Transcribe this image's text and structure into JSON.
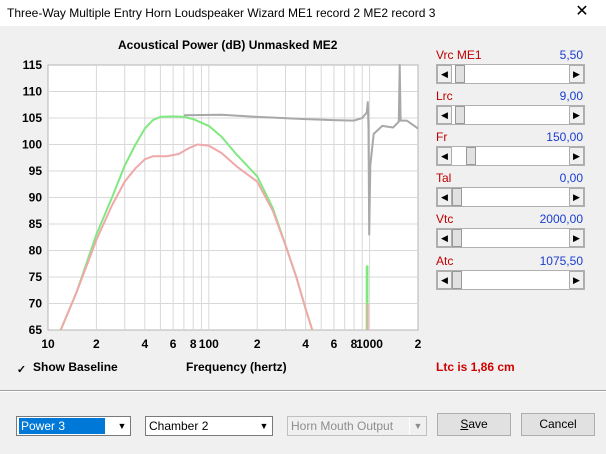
{
  "window": {
    "title": "Three-Way Multiple Entry Horn Loudspeaker Wizard   ME1 record 2   ME2 record 3",
    "close_glyph": "✕"
  },
  "chart_data": {
    "type": "line",
    "title": "Acoustical Power (dB)   Unmasked   ME2",
    "xlabel": "Frequency (hertz)",
    "ylabel": "",
    "x_scale": "log",
    "xlim": [
      10,
      2000
    ],
    "ylim": [
      65,
      115
    ],
    "yticks": [
      "115",
      "110",
      "105",
      "100",
      "95",
      "90",
      "85",
      "80",
      "75",
      "70",
      "65"
    ],
    "xticks": [
      "10",
      "2",
      "4",
      "6",
      "8",
      "100",
      "2",
      "4",
      "6",
      "8",
      "1000",
      "2"
    ],
    "grid": true,
    "series": [
      {
        "color": "#a8a8a8",
        "points": [
          [
            70,
            105.5
          ],
          [
            120,
            105.6
          ],
          [
            200,
            105.2
          ],
          [
            400,
            104.8
          ],
          [
            600,
            104.6
          ],
          [
            800,
            104.5
          ],
          [
            900,
            105
          ],
          [
            960,
            106
          ],
          [
            975,
            108
          ],
          [
            985,
            103
          ],
          [
            995,
            83
          ],
          [
            1010,
            96
          ],
          [
            1060,
            102
          ],
          [
            1200,
            103.5
          ],
          [
            1400,
            103.2
          ],
          [
            1520,
            104.3
          ],
          [
            1540,
            115
          ],
          [
            1560,
            104.5
          ],
          [
            1700,
            104.5
          ],
          [
            1900,
            103.5
          ],
          [
            2000,
            103
          ]
        ]
      },
      {
        "color": "#80e880",
        "points": [
          [
            12,
            65
          ],
          [
            15,
            72
          ],
          [
            20,
            83
          ],
          [
            25,
            90
          ],
          [
            30,
            96
          ],
          [
            35,
            100
          ],
          [
            40,
            103
          ],
          [
            45,
            104.6
          ],
          [
            50,
            105.2
          ],
          [
            60,
            105.3
          ],
          [
            70,
            105.2
          ],
          [
            80,
            104.8
          ],
          [
            100,
            103.5
          ],
          [
            120,
            101.5
          ],
          [
            150,
            98
          ],
          [
            200,
            94
          ],
          [
            250,
            88
          ],
          [
            300,
            81
          ],
          [
            350,
            75
          ],
          [
            400,
            69
          ],
          [
            440,
            65
          ]
        ]
      },
      {
        "color": "#f0a8a8",
        "points": [
          [
            12,
            65
          ],
          [
            15,
            72
          ],
          [
            20,
            82
          ],
          [
            25,
            88.5
          ],
          [
            30,
            93
          ],
          [
            35,
            95.5
          ],
          [
            40,
            97.2
          ],
          [
            45,
            97.8
          ],
          [
            55,
            97.8
          ],
          [
            65,
            98.2
          ],
          [
            75,
            99.3
          ],
          [
            85,
            100
          ],
          [
            100,
            99.8
          ],
          [
            120,
            98.4
          ],
          [
            150,
            95.8
          ],
          [
            200,
            93
          ],
          [
            250,
            87.5
          ],
          [
            300,
            81
          ],
          [
            350,
            75
          ],
          [
            400,
            69
          ],
          [
            440,
            65
          ]
        ]
      },
      {
        "color": "#80e880",
        "points": [
          [
            960,
            65
          ],
          [
            960,
            77
          ],
          [
            970,
            77
          ],
          [
            970,
            65
          ]
        ]
      },
      {
        "color": "#f0a8a8",
        "points": [
          [
            975,
            65
          ],
          [
            975,
            70
          ]
        ]
      }
    ]
  },
  "show_baseline": {
    "label": "Show Baseline",
    "checked": true,
    "check_glyph": "✓"
  },
  "status": "Ltc is 1,86 cm",
  "sliders": [
    {
      "label": "Vrc  ME1",
      "value": "5,50",
      "position": 0.03
    },
    {
      "label": "Lrc",
      "value": "9,00",
      "position": 0.03
    },
    {
      "label": "Fr",
      "value": "150,00",
      "position": 0.13
    },
    {
      "label": "Tal",
      "value": "0,00",
      "position": 0.0
    },
    {
      "label": "Vtc",
      "value": "2000,00",
      "position": 0.0
    },
    {
      "label": "Atc",
      "value": "1075,50",
      "position": 0.0
    }
  ],
  "arrows": {
    "left": "◀",
    "right": "▶",
    "down": "▼"
  },
  "bottom": {
    "power": "Power 3",
    "chamber": "Chamber 2",
    "output": "Horn Mouth Output",
    "save": "Save",
    "cancel": "Cancel"
  }
}
